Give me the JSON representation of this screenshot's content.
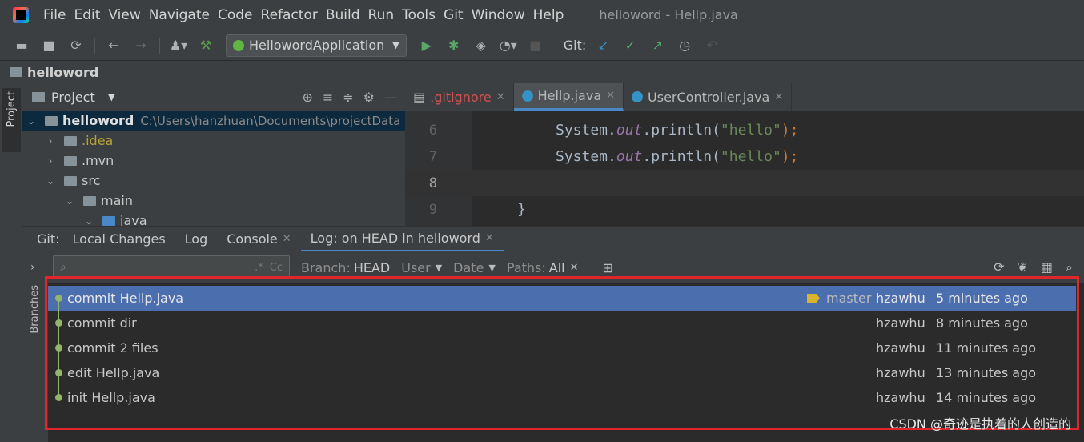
{
  "menubar": {
    "items": [
      "File",
      "Edit",
      "View",
      "Navigate",
      "Code",
      "Refactor",
      "Build",
      "Run",
      "Tools",
      "Git",
      "Window",
      "Help"
    ],
    "title": "helloword - Hellp.java"
  },
  "toolbar": {
    "run_config": "HellowordApplication",
    "git_label": "Git:"
  },
  "navbar": {
    "project": "helloword"
  },
  "sidebar": {
    "project_stripe": "Project"
  },
  "project_panel": {
    "title": "Project",
    "tree": [
      {
        "label": "helloword",
        "path": "C:\\Users\\hanzhuan\\Documents\\projectData"
      },
      {
        "label": ".idea"
      },
      {
        "label": ".mvn"
      },
      {
        "label": "src"
      },
      {
        "label": "main"
      },
      {
        "label": "java"
      }
    ]
  },
  "editor": {
    "tabs": [
      ".gitignore",
      "Hellp.java",
      "UserController.java"
    ],
    "lines": [
      {
        "num": "6",
        "code": "System.out.println(\"hello\");"
      },
      {
        "num": "7",
        "code": "System.out.println(\"hello\");"
      },
      {
        "num": "8",
        "code": ""
      },
      {
        "num": "9",
        "code": "}"
      }
    ]
  },
  "git_panel": {
    "label": "Git:",
    "tabs": [
      "Local Changes",
      "Log",
      "Console",
      "Log: on HEAD in helloword"
    ],
    "branches_label": "Branches",
    "filters": {
      "branch_label": "Branch:",
      "branch_value": "HEAD",
      "user": "User",
      "date": "Date",
      "paths_label": "Paths:",
      "paths_value": "All"
    },
    "search_opts": [
      ".*",
      "Cc"
    ],
    "commits": [
      {
        "message": "commit Hellp.java",
        "branch": "master",
        "author": "hzawhu",
        "date": "5 minutes ago"
      },
      {
        "message": "commit dir",
        "author": "hzawhu",
        "date": "8 minutes ago"
      },
      {
        "message": "commit 2 files",
        "author": "hzawhu",
        "date": "11 minutes ago"
      },
      {
        "message": "edit Hellp.java",
        "author": "hzawhu",
        "date": "13 minutes ago"
      },
      {
        "message": "init Hellp.java",
        "author": "hzawhu",
        "date": "14 minutes ago"
      }
    ]
  },
  "watermark": "CSDN @奇迹是执着的人创造的",
  "colors": {
    "highlight": "#e0262b",
    "selection": "#4b6eaf",
    "graph": "#94b46a"
  }
}
